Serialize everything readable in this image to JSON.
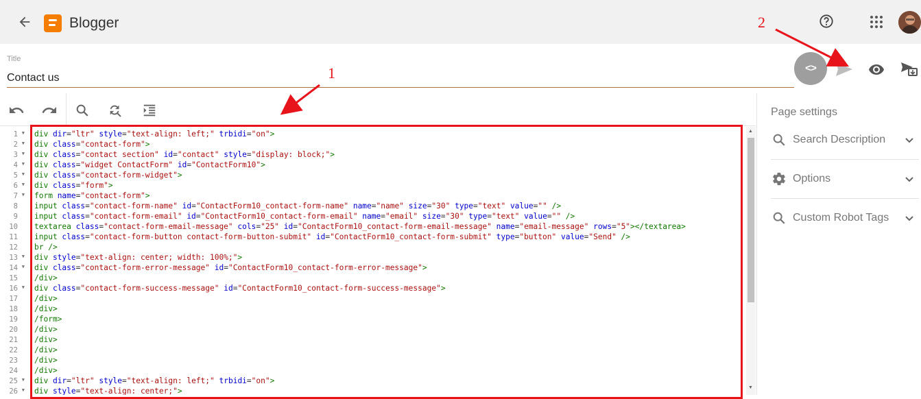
{
  "app": {
    "title": "Blogger"
  },
  "topbar": {
    "back_icon": "arrow-back-icon",
    "help_icon": "help-circle-icon",
    "apps_icon": "apps-grid-icon"
  },
  "post": {
    "title_label": "Title",
    "title_value": "Contact us"
  },
  "editor": {
    "lines": [
      {
        "n": "1",
        "fold": "▼",
        "tokens": [
          [
            "t",
            "div"
          ],
          [
            "a",
            " dir"
          ],
          [
            "x",
            "="
          ],
          [
            "s",
            "\"ltr\""
          ],
          [
            "a",
            " style"
          ],
          [
            "x",
            "="
          ],
          [
            "s",
            "\"text-align: left;\""
          ],
          [
            "a",
            " trbidi"
          ],
          [
            "x",
            "="
          ],
          [
            "s",
            "\"on\""
          ],
          [
            "t",
            ">"
          ]
        ]
      },
      {
        "n": "2",
        "fold": "▼",
        "tokens": [
          [
            "t",
            "div"
          ],
          [
            "a",
            " class"
          ],
          [
            "x",
            "="
          ],
          [
            "s",
            "\"contact-form\""
          ],
          [
            "t",
            ">"
          ]
        ]
      },
      {
        "n": "3",
        "fold": "▼",
        "tokens": [
          [
            "t",
            "div"
          ],
          [
            "a",
            " class"
          ],
          [
            "x",
            "="
          ],
          [
            "s",
            "\"contact section\""
          ],
          [
            "a",
            " id"
          ],
          [
            "x",
            "="
          ],
          [
            "s",
            "\"contact\""
          ],
          [
            "a",
            " style"
          ],
          [
            "x",
            "="
          ],
          [
            "s",
            "\"display: block;\""
          ],
          [
            "t",
            ">"
          ]
        ]
      },
      {
        "n": "4",
        "fold": "▼",
        "tokens": [
          [
            "t",
            "div"
          ],
          [
            "a",
            " class"
          ],
          [
            "x",
            "="
          ],
          [
            "s",
            "\"widget ContactForm\""
          ],
          [
            "a",
            " id"
          ],
          [
            "x",
            "="
          ],
          [
            "s",
            "\"ContactForm10\""
          ],
          [
            "t",
            ">"
          ]
        ]
      },
      {
        "n": "5",
        "fold": "▼",
        "tokens": [
          [
            "t",
            "div"
          ],
          [
            "a",
            " class"
          ],
          [
            "x",
            "="
          ],
          [
            "s",
            "\"contact-form-widget\""
          ],
          [
            "t",
            ">"
          ]
        ]
      },
      {
        "n": "6",
        "fold": "▼",
        "tokens": [
          [
            "t",
            "div"
          ],
          [
            "a",
            " class"
          ],
          [
            "x",
            "="
          ],
          [
            "s",
            "\"form\""
          ],
          [
            "t",
            ">"
          ]
        ]
      },
      {
        "n": "7",
        "fold": "▼",
        "tokens": [
          [
            "t",
            "form"
          ],
          [
            "a",
            " name"
          ],
          [
            "x",
            "="
          ],
          [
            "s",
            "\"contact-form\""
          ],
          [
            "t",
            ">"
          ]
        ]
      },
      {
        "n": "8",
        "fold": "",
        "tokens": [
          [
            "t",
            "input"
          ],
          [
            "a",
            " class"
          ],
          [
            "x",
            "="
          ],
          [
            "s",
            "\"contact-form-name\""
          ],
          [
            "a",
            " id"
          ],
          [
            "x",
            "="
          ],
          [
            "s",
            "\"ContactForm10_contact-form-name\""
          ],
          [
            "a",
            " name"
          ],
          [
            "x",
            "="
          ],
          [
            "s",
            "\"name\""
          ],
          [
            "a",
            " size"
          ],
          [
            "x",
            "="
          ],
          [
            "s",
            "\"30\""
          ],
          [
            "a",
            " type"
          ],
          [
            "x",
            "="
          ],
          [
            "s",
            "\"text\""
          ],
          [
            "a",
            " value"
          ],
          [
            "x",
            "="
          ],
          [
            "s",
            "\"\""
          ],
          [
            "t",
            " />"
          ]
        ]
      },
      {
        "n": "9",
        "fold": "",
        "tokens": [
          [
            "t",
            "input"
          ],
          [
            "a",
            " class"
          ],
          [
            "x",
            "="
          ],
          [
            "s",
            "\"contact-form-email\""
          ],
          [
            "a",
            " id"
          ],
          [
            "x",
            "="
          ],
          [
            "s",
            "\"ContactForm10_contact-form-email\""
          ],
          [
            "a",
            " name"
          ],
          [
            "x",
            "="
          ],
          [
            "s",
            "\"email\""
          ],
          [
            "a",
            " size"
          ],
          [
            "x",
            "="
          ],
          [
            "s",
            "\"30\""
          ],
          [
            "a",
            " type"
          ],
          [
            "x",
            "="
          ],
          [
            "s",
            "\"text\""
          ],
          [
            "a",
            " value"
          ],
          [
            "x",
            "="
          ],
          [
            "s",
            "\"\""
          ],
          [
            "t",
            " />"
          ]
        ]
      },
      {
        "n": "10",
        "fold": "",
        "tokens": [
          [
            "t",
            "textarea"
          ],
          [
            "a",
            " class"
          ],
          [
            "x",
            "="
          ],
          [
            "s",
            "\"contact-form-email-message\""
          ],
          [
            "a",
            " cols"
          ],
          [
            "x",
            "="
          ],
          [
            "s",
            "\"25\""
          ],
          [
            "a",
            " id"
          ],
          [
            "x",
            "="
          ],
          [
            "s",
            "\"ContactForm10_contact-form-email-message\""
          ],
          [
            "a",
            " name"
          ],
          [
            "x",
            "="
          ],
          [
            "s",
            "\"email-message\""
          ],
          [
            "a",
            " rows"
          ],
          [
            "x",
            "="
          ],
          [
            "s",
            "\"5\""
          ],
          [
            "t",
            "></textarea>"
          ]
        ]
      },
      {
        "n": "11",
        "fold": "",
        "tokens": [
          [
            "t",
            "input"
          ],
          [
            "a",
            " class"
          ],
          [
            "x",
            "="
          ],
          [
            "s",
            "\"contact-form-button contact-form-button-submit\""
          ],
          [
            "a",
            " id"
          ],
          [
            "x",
            "="
          ],
          [
            "s",
            "\"ContactForm10_contact-form-submit\""
          ],
          [
            "a",
            " type"
          ],
          [
            "x",
            "="
          ],
          [
            "s",
            "\"button\""
          ],
          [
            "a",
            " value"
          ],
          [
            "x",
            "="
          ],
          [
            "s",
            "\"Send\""
          ],
          [
            "t",
            " />"
          ]
        ]
      },
      {
        "n": "12",
        "fold": "",
        "tokens": [
          [
            "t",
            "br />"
          ]
        ]
      },
      {
        "n": "13",
        "fold": "▼",
        "tokens": [
          [
            "t",
            "div"
          ],
          [
            "a",
            " style"
          ],
          [
            "x",
            "="
          ],
          [
            "s",
            "\"text-align: center; width: 100%;\""
          ],
          [
            "t",
            ">"
          ]
        ]
      },
      {
        "n": "14",
        "fold": "▼",
        "tokens": [
          [
            "t",
            "div"
          ],
          [
            "a",
            " class"
          ],
          [
            "x",
            "="
          ],
          [
            "s",
            "\"contact-form-error-message\""
          ],
          [
            "a",
            " id"
          ],
          [
            "x",
            "="
          ],
          [
            "s",
            "\"ContactForm10_contact-form-error-message\""
          ],
          [
            "t",
            ">"
          ]
        ]
      },
      {
        "n": "15",
        "fold": "",
        "tokens": [
          [
            "t",
            "/div>"
          ]
        ]
      },
      {
        "n": "16",
        "fold": "▼",
        "tokens": [
          [
            "t",
            "div"
          ],
          [
            "a",
            " class"
          ],
          [
            "x",
            "="
          ],
          [
            "s",
            "\"contact-form-success-message\""
          ],
          [
            "a",
            " id"
          ],
          [
            "x",
            "="
          ],
          [
            "s",
            "\"ContactForm10_contact-form-success-message\""
          ],
          [
            "t",
            ">"
          ]
        ]
      },
      {
        "n": "17",
        "fold": "",
        "tokens": [
          [
            "t",
            "/div>"
          ]
        ]
      },
      {
        "n": "18",
        "fold": "",
        "tokens": [
          [
            "t",
            "/div>"
          ]
        ]
      },
      {
        "n": "19",
        "fold": "",
        "tokens": [
          [
            "t",
            "/form>"
          ]
        ]
      },
      {
        "n": "20",
        "fold": "",
        "tokens": [
          [
            "t",
            "/div>"
          ]
        ]
      },
      {
        "n": "21",
        "fold": "",
        "tokens": [
          [
            "t",
            "/div>"
          ]
        ]
      },
      {
        "n": "22",
        "fold": "",
        "tokens": [
          [
            "t",
            "/div>"
          ]
        ]
      },
      {
        "n": "23",
        "fold": "",
        "tokens": [
          [
            "t",
            "/div>"
          ]
        ]
      },
      {
        "n": "24",
        "fold": "",
        "tokens": [
          [
            "t",
            "/div>"
          ]
        ]
      },
      {
        "n": "25",
        "fold": "▼",
        "tokens": [
          [
            "t",
            "div"
          ],
          [
            "a",
            " dir"
          ],
          [
            "x",
            "="
          ],
          [
            "s",
            "\"ltr\""
          ],
          [
            "a",
            " style"
          ],
          [
            "x",
            "="
          ],
          [
            "s",
            "\"text-align: left;\""
          ],
          [
            "a",
            " trbidi"
          ],
          [
            "x",
            "="
          ],
          [
            "s",
            "\"on\""
          ],
          [
            "t",
            ">"
          ]
        ]
      },
      {
        "n": "26",
        "fold": "▼",
        "tokens": [
          [
            "t",
            "div"
          ],
          [
            "a",
            " style"
          ],
          [
            "x",
            "="
          ],
          [
            "s",
            "\"text-align: center;\""
          ],
          [
            "t",
            ">"
          ]
        ]
      }
    ]
  },
  "side_panel": {
    "heading": "Page settings",
    "items": [
      {
        "label": "Search Description",
        "icon": "search-icon"
      },
      {
        "label": "Options",
        "icon": "gear-icon"
      },
      {
        "label": "Custom Robot Tags",
        "icon": "search-icon"
      }
    ]
  },
  "annotations": {
    "one": "1",
    "two": "2"
  },
  "colors": {
    "accent_orange": "#f57d00",
    "annotation_red": "#e8141c",
    "toggle_gray": "#9e9e9e"
  }
}
